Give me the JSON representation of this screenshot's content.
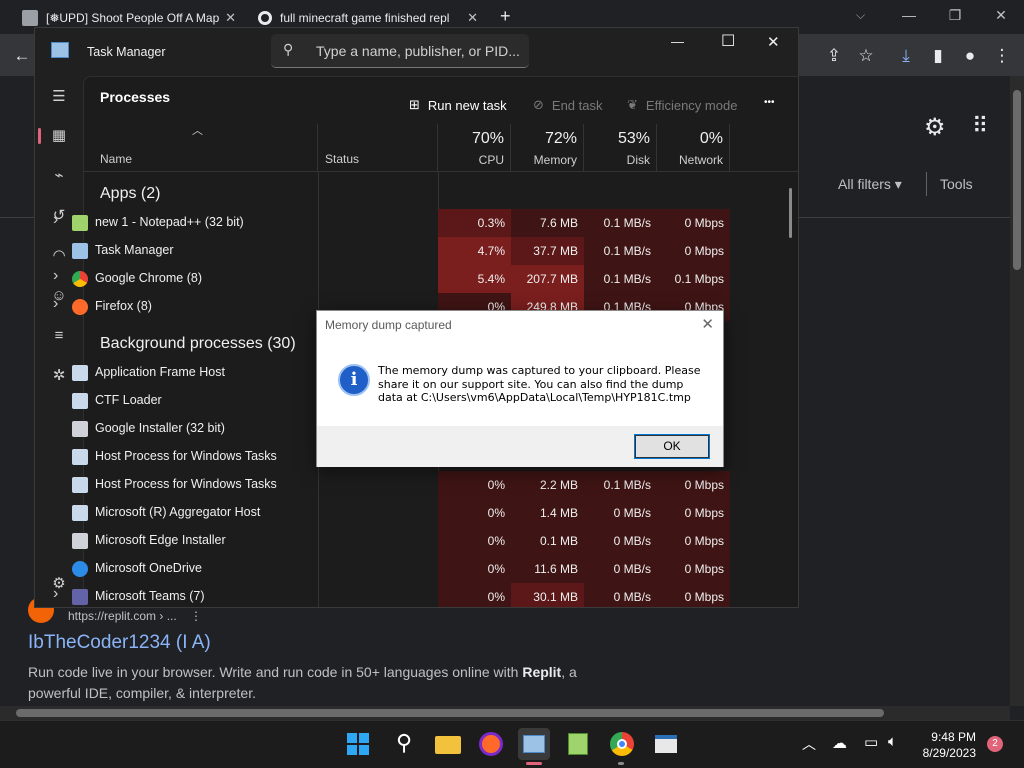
{
  "browser": {
    "tabs": [
      {
        "title": "[❅UPD] Shoot People Off A Map"
      },
      {
        "title": "full minecraft game finished repl"
      }
    ],
    "new_tab": "+",
    "window_controls": {
      "minimize": "—",
      "restore": "❐",
      "close": "✕"
    }
  },
  "search_page": {
    "filters": {
      "all_filters": "All filters",
      "tools": "Tools"
    },
    "result": {
      "url": "https://replit.com › ...",
      "title": "IbTheCoder1234 (I A)",
      "snippet_pre": "Run code live in your browser. Write and run code in 50+ languages online with ",
      "snippet_bold": "Replit",
      "snippet_post": ", a powerful IDE, compiler, & interpreter."
    }
  },
  "task_manager": {
    "title": "Task Manager",
    "search_placeholder": "Type a name, publisher, or PID...",
    "window_controls": {
      "minimize": "—",
      "maximize": "☐",
      "close": "✕"
    },
    "section_title": "Processes",
    "commands": {
      "run_new_task": "Run new task",
      "end_task": "End task",
      "efficiency_mode": "Efficiency mode",
      "more": "•••"
    },
    "columns": {
      "name": "Name",
      "status": "Status",
      "cpu": {
        "pct": "70%",
        "label": "CPU"
      },
      "memory": {
        "pct": "72%",
        "label": "Memory"
      },
      "disk": {
        "pct": "53%",
        "label": "Disk"
      },
      "network": {
        "pct": "0%",
        "label": "Network"
      }
    },
    "groups": {
      "apps": "Apps (2)",
      "background": "Background processes (30)"
    },
    "apps": [
      {
        "name": "new 1 - Notepad++ (32 bit)",
        "cpu": "0.3%",
        "mem": "7.6 MB",
        "disk": "0.1 MB/s",
        "net": "0 Mbps"
      },
      {
        "name": "Task Manager",
        "cpu": "4.7%",
        "mem": "37.7 MB",
        "disk": "0.1 MB/s",
        "net": "0 Mbps"
      },
      {
        "name": "Google Chrome (8)",
        "cpu": "5.4%",
        "mem": "207.7 MB",
        "disk": "0.1 MB/s",
        "net": "0.1 Mbps"
      },
      {
        "name": "Firefox (8)",
        "cpu": "0%",
        "mem": "249.8 MB",
        "disk": "0.1 MB/s",
        "net": "0 Mbps"
      }
    ],
    "background": [
      {
        "name": "Application Frame Host",
        "cpu": "",
        "mem": "",
        "disk": "",
        "net": ""
      },
      {
        "name": "CTF Loader",
        "cpu": "",
        "mem": "",
        "disk": "",
        "net": ""
      },
      {
        "name": "Google Installer (32 bit)",
        "cpu": "",
        "mem": "",
        "disk": "",
        "net": ""
      },
      {
        "name": "Host Process for Windows Tasks",
        "cpu": "",
        "mem": "",
        "disk": "",
        "net": ""
      },
      {
        "name": "Host Process for Windows Tasks",
        "cpu": "0%",
        "mem": "2.2 MB",
        "disk": "0.1 MB/s",
        "net": "0 Mbps"
      },
      {
        "name": "Microsoft (R) Aggregator Host",
        "cpu": "0%",
        "mem": "1.4 MB",
        "disk": "0 MB/s",
        "net": "0 Mbps"
      },
      {
        "name": "Microsoft Edge Installer",
        "cpu": "0%",
        "mem": "0.1 MB",
        "disk": "0 MB/s",
        "net": "0 Mbps"
      },
      {
        "name": "Microsoft OneDrive",
        "cpu": "0%",
        "mem": "11.6 MB",
        "disk": "0 MB/s",
        "net": "0 Mbps"
      },
      {
        "name": "Microsoft Teams (7)",
        "cpu": "0%",
        "mem": "30.1 MB",
        "disk": "0 MB/s",
        "net": "0 Mbps"
      }
    ]
  },
  "dialog": {
    "title": "Memory dump captured",
    "message": "The memory dump was captured to your clipboard. Please share it on our support site. You can also find the dump data at C:\\Users\\vm6\\AppData\\Local\\Temp\\HYP181C.tmp",
    "ok": "OK",
    "close": "✕"
  },
  "taskbar": {
    "time": "9:48 PM",
    "date": "8/29/2023",
    "notification_count": "2"
  },
  "colors": {
    "accent_pink": "#e0647a",
    "heat_low": "#3f1414",
    "heat_mid": "#5c1818",
    "heat_high": "#7a1e1e",
    "link_blue": "#8ab4f8"
  }
}
